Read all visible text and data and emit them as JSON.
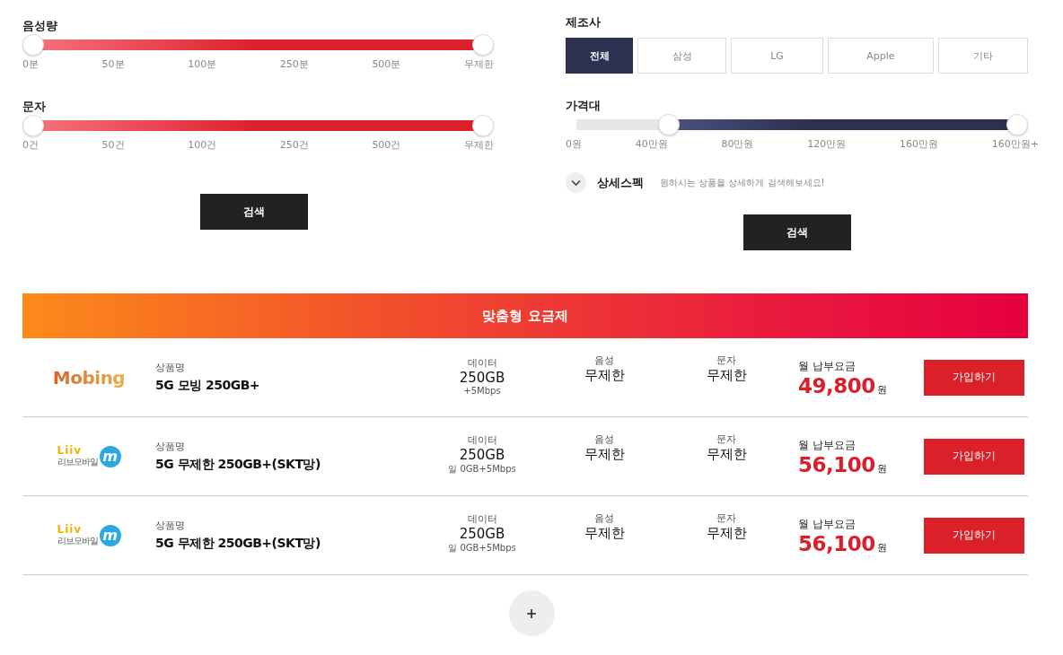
{
  "filters_left": [
    {
      "label": "음성량",
      "kind": "red",
      "thumbs": [
        {
          "level": 0
        },
        {
          "level": 1
        }
      ],
      "ticks": [
        "0분",
        "50분",
        "100분",
        "250분",
        "500분",
        "무제한"
      ]
    },
    {
      "label": "문자",
      "kind": "red",
      "thumbs": [
        {
          "level": 0
        },
        {
          "level": 1
        }
      ],
      "ticks": [
        "0건",
        "50건",
        "100건",
        "250건",
        "500건",
        "무제한"
      ]
    }
  ],
  "search_left": "검색",
  "manufacturer": {
    "label": "제조사",
    "options": [
      {
        "label": "전체",
        "selected": true
      },
      {
        "label": "삼성",
        "selected": false
      },
      {
        "label": "LG",
        "selected": false
      },
      {
        "label": "Apple",
        "selected": false
      },
      {
        "label": "기타",
        "selected": false
      }
    ]
  },
  "price": {
    "label": "가격대",
    "kind": "navy",
    "thumbs": [
      {
        "level": 0.21
      },
      {
        "level": 1
      }
    ],
    "ticks": [
      "0원",
      "40만원",
      "80만원",
      "120만원",
      "160만원",
      "160만원+"
    ]
  },
  "detail_spec": {
    "title": "상세스펙",
    "hint": "원하시는 상품을 상세하게 검색해보세요!",
    "expanded": false
  },
  "search_right": "검색",
  "banner": "맞춤형 요금제",
  "plans": [
    {
      "logo": {
        "kind": "mobing",
        "text": "Mobing"
      },
      "name_label": "상품명",
      "name": "5G 모빙 250GB+",
      "data_label": "데이터",
      "data": "250GB",
      "data_note": "+5Mbps",
      "voice_label": "음성",
      "voice": "무제한",
      "sms_label": "문자",
      "sms": "무제한",
      "fee_label": "월 납부요금",
      "fee": "49,800",
      "unit": "원",
      "button": "가입하기"
    },
    {
      "logo": {
        "kind": "liiv",
        "text": "Liiv",
        "mark": "m",
        "sub": "리브모바일"
      },
      "name_label": "상품명",
      "name": "5G 무제한 250GB+(SKT망)",
      "data_label": "데이터",
      "data": "250GB",
      "data_note": "일 0GB+5Mbps",
      "voice_label": "음성",
      "voice": "무제한",
      "sms_label": "문자",
      "sms": "무제한",
      "fee_label": "월 납부요금",
      "fee": "56,100",
      "unit": "원",
      "button": "가입하기"
    },
    {
      "logo": {
        "kind": "liiv",
        "text": "Liiv",
        "mark": "m",
        "sub": "리브모바일"
      },
      "name_label": "상품명",
      "name": "5G 무제한 250GB+(SKT망)",
      "data_label": "데이터",
      "data": "250GB",
      "data_note": "일 0GB+5Mbps",
      "voice_label": "음성",
      "voice": "무제한",
      "sms_label": "문자",
      "sms": "무제한",
      "fee_label": "월 납부요금",
      "fee": "56,100",
      "unit": "원",
      "button": "가입하기"
    }
  ],
  "more_button": "+"
}
